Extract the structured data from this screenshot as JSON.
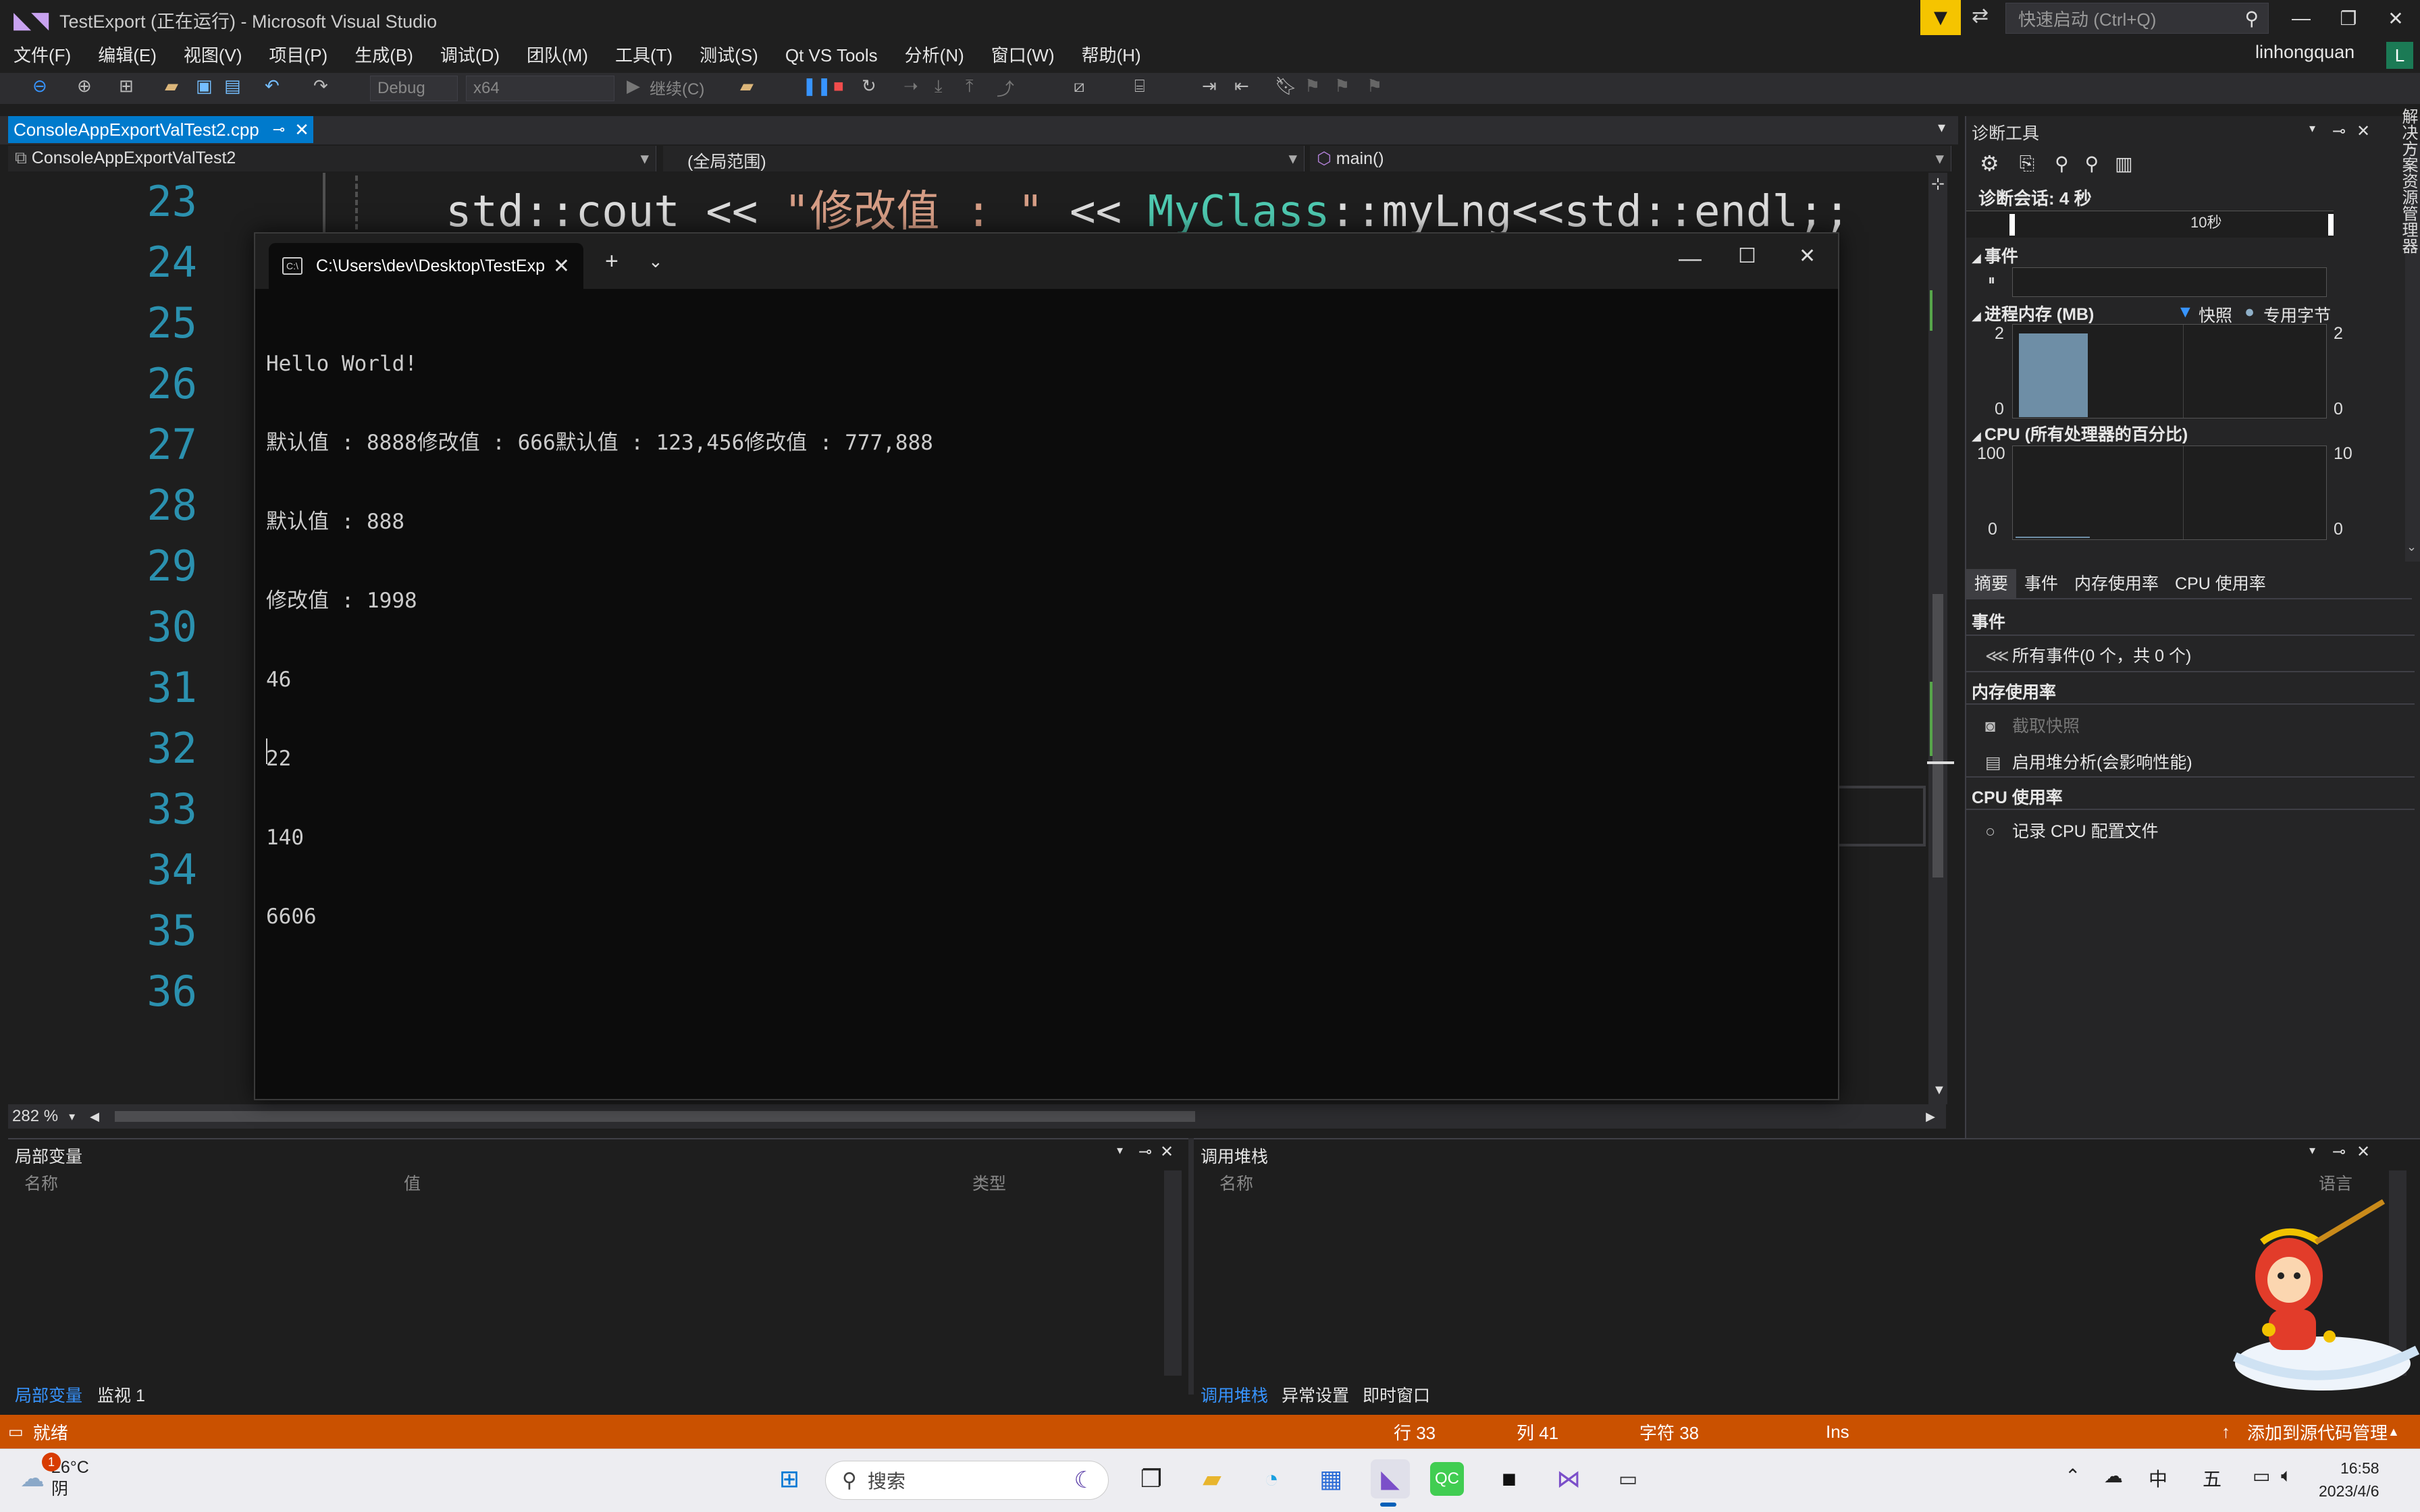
{
  "window": {
    "title": "TestExport (正在运行) - Microsoft Visual Studio",
    "quick_launch_placeholder": "快速启动 (Ctrl+Q)"
  },
  "menu": [
    "文件(F)",
    "编辑(E)",
    "视图(V)",
    "项目(P)",
    "生成(B)",
    "调试(D)",
    "团队(M)",
    "工具(T)",
    "测试(S)",
    "Qt VS Tools",
    "分析(N)",
    "窗口(W)",
    "帮助(H)"
  ],
  "user": {
    "name": "linhongquan",
    "initial": "L"
  },
  "toolbar": {
    "config": "Debug",
    "platform": "x64",
    "continue_label": "继续(C)"
  },
  "editor": {
    "tab_label": "ConsoleAppExportValTest2.cpp",
    "nav_project": "ConsoleAppExportValTest2",
    "nav_scope": "(全局范围)",
    "nav_member": "main()",
    "line_numbers": [
      "23",
      "24",
      "25",
      "26",
      "27",
      "28",
      "29",
      "30",
      "31",
      "32",
      "33",
      "34",
      "35",
      "36"
    ],
    "code": {
      "a": "std::cout << ",
      "b": "\"修改值 : \"",
      "c": " << ",
      "d": "MyClass",
      "e": "::myLng<<std::endl;;"
    },
    "zoom": "282 %"
  },
  "console": {
    "tab_title": "C:\\Users\\dev\\Desktop\\TestExp",
    "output": [
      "Hello World!",
      "默认值 : 8888修改值 : 666默认值 : 123,456修改值 : 777,888",
      "默认值 : 888",
      "修改值 : 1998",
      "46",
      "22",
      "140",
      "6606"
    ]
  },
  "diagnostics": {
    "title": "诊断工具",
    "session": "诊断会话: 4 秒",
    "timeline_label": "10秒",
    "events_header": "事件",
    "memory_header": "进程内存 (MB)",
    "memory_legend": [
      "快照",
      "专用字节"
    ],
    "memory_axis": {
      "max": "2",
      "min": "0",
      "right_max": "2",
      "right_min": "0"
    },
    "cpu_header": "CPU (所有处理器的百分比)",
    "cpu_axis": {
      "max": "100",
      "min": "0",
      "right_max": "10",
      "right_min": "0"
    },
    "tabs": [
      "摘要",
      "事件",
      "内存使用率",
      "CPU 使用率"
    ],
    "summary": {
      "events_title": "事件",
      "all_events": "所有事件(0 个，共 0 个)",
      "memory_title": "内存使用率",
      "snapshot": "截取快照",
      "heap": "启用堆分析(会影响性能)",
      "cpu_title": "CPU 使用率",
      "record_cpu": "记录 CPU 配置文件"
    },
    "right_rail": "解决方案资源管理器"
  },
  "locals": {
    "title": "局部变量",
    "columns": [
      "名称",
      "值",
      "类型"
    ],
    "tabs": [
      "局部变量",
      "监视 1"
    ]
  },
  "callstack": {
    "title": "调用堆栈",
    "columns": [
      "名称",
      "语言"
    ],
    "tabs": [
      "调用堆栈",
      "异常设置",
      "即时窗口"
    ]
  },
  "status": {
    "ready": "就绪",
    "line": "行 33",
    "col": "列 41",
    "char": "字符 38",
    "mode": "Ins",
    "source_control": "添加到源代码管理"
  },
  "taskbar": {
    "weather_temp": "26°C",
    "weather_desc": "阴",
    "badge": "1",
    "search_placeholder": "搜索",
    "ime": "中",
    "ime2": "五",
    "time": "16:58",
    "date": "2023/4/6"
  },
  "colors": {
    "accent": "#007acc",
    "status_bar": "#ca5100",
    "line_number": "#2b91af"
  }
}
